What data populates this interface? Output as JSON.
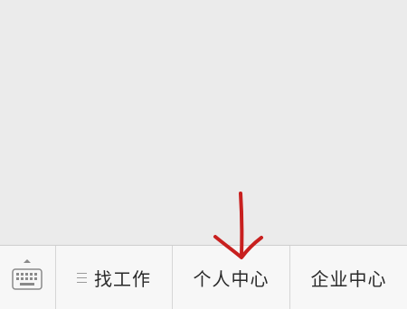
{
  "bottom_bar": {
    "keyboard_toggle": {
      "icon": "keyboard-icon",
      "caret_icon": "chevron-up-icon"
    },
    "tabs": [
      {
        "label": "找工作",
        "icon": "menu-icon"
      },
      {
        "label": "个人中心"
      },
      {
        "label": "企业中心"
      }
    ]
  },
  "annotation": {
    "arrow_color": "#c8201f",
    "points_to": "个人中心"
  },
  "colors": {
    "background": "#ebebeb",
    "bar_background": "#f7f7f7",
    "divider": "#d6d6d6",
    "text": "#2a2a2a"
  }
}
